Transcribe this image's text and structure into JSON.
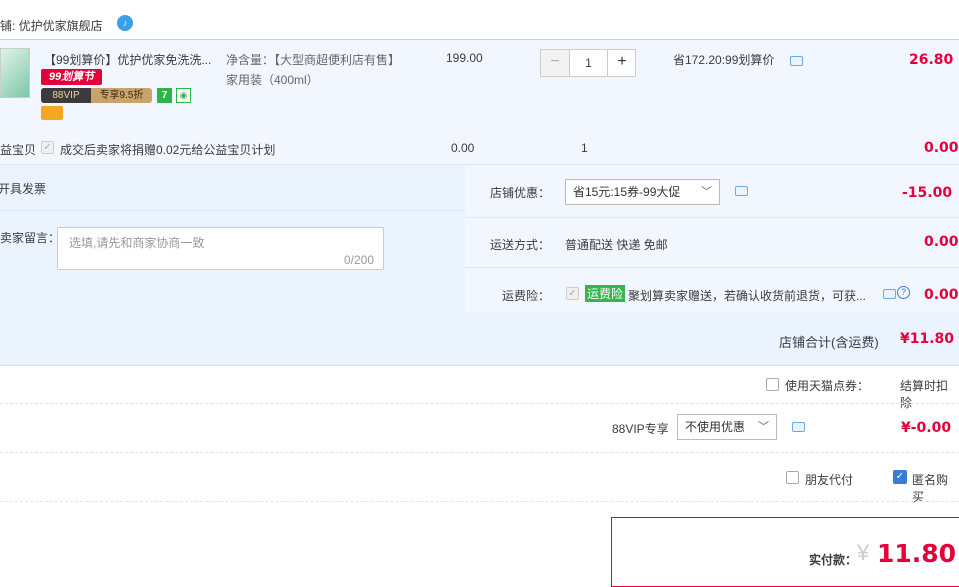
{
  "store": {
    "label": "店铺: 优护优家旗舰店"
  },
  "item": {
    "title": "【99划算价】优护优家免洗洗...",
    "tag_99": "99划算节",
    "vip_left": "88VIP",
    "vip_right": "专享9.5折",
    "badge_7": "7",
    "spec_line1": "净含量：【大型商超便利店有售】",
    "spec_line2": "家用装（400ml）",
    "unit_price": "199.00",
    "quantity": "1",
    "minus": "−",
    "plus": "+",
    "save_text": "省172.20:99划算价",
    "subtotal": "26.80"
  },
  "charity": {
    "label": "公益宝贝",
    "text": "成交后卖家将捐赠0.02元给公益宝贝计划",
    "price": "0.00",
    "qty": "1",
    "subtotal": "0.00"
  },
  "invoice": {
    "label": "开具发票"
  },
  "message": {
    "label": "给卖家留言：",
    "placeholder": "选填,请先和商家协商一致",
    "counter": "0/200"
  },
  "coupon": {
    "label": "店铺优惠：",
    "value": "省15元:15券-99大促",
    "amount": "-15.00"
  },
  "shipping": {
    "label": "运送方式：",
    "value": "普通配送 快递 免邮",
    "amount": "0.00"
  },
  "insurance": {
    "label": "运费险：",
    "badge": "运费险",
    "text": "聚划算卖家赠送，若确认收货前退货，可获...",
    "amount": "0.00"
  },
  "store_total": {
    "label": "店铺合计(含运费)",
    "amount": "¥11.80"
  },
  "tmall_coupon": {
    "label": "使用天猫点券：",
    "value": "结算时扣除"
  },
  "vip88": {
    "label": "88VIP专享",
    "select": "不使用优惠",
    "amount": "¥-0.00"
  },
  "options": {
    "friend_pay": "朋友代付",
    "anonymous": "匿名购买"
  },
  "pay": {
    "label": "实付款：",
    "currency": "¥",
    "amount": "11.80"
  },
  "colors": {
    "accent_red": "#e4003a",
    "blue_bg": "#eaf3ff",
    "green": "#38b54a"
  }
}
